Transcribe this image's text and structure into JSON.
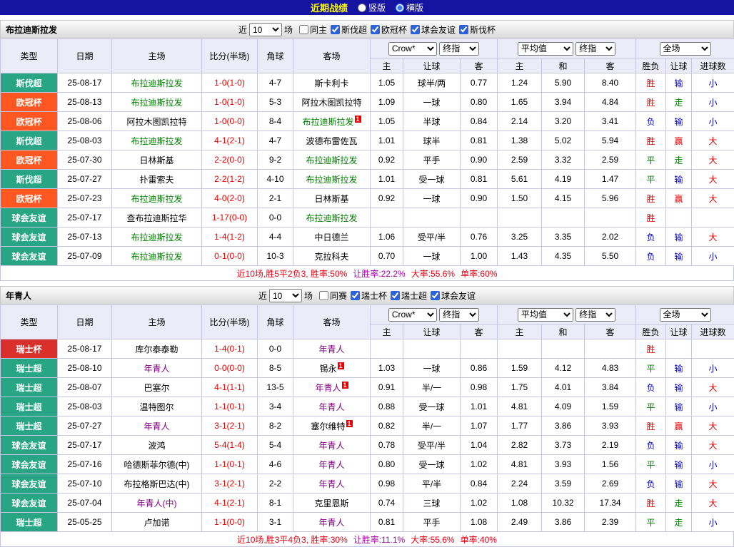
{
  "topbar": {
    "title": "近期战绩",
    "radios": [
      {
        "label": "竖版",
        "selected": false
      },
      {
        "label": "横版",
        "selected": true
      }
    ]
  },
  "table_header": {
    "type": "类型",
    "date": "日期",
    "home": "主场",
    "score": "比分(半场)",
    "corner": "角球",
    "away": "客场",
    "asia_selects": [
      "Crow*",
      "终指"
    ],
    "asia_cols": [
      "主",
      "让球",
      "客"
    ],
    "europe_selects": [
      "平均值",
      "终指"
    ],
    "europe_cols": [
      "主",
      "和",
      "客"
    ],
    "result_select": "全场",
    "result_cols": [
      "胜负",
      "让球",
      "进球数"
    ]
  },
  "league_colors": {
    "斯伐超": "#27a584",
    "欧冠杯": "#ff5722",
    "球会友谊": "#27a584",
    "瑞士杯": "#d9302c",
    "瑞士超": "#27a584"
  },
  "result_colors": {
    "胜": "#e60000",
    "平": "#008000",
    "负": "#0000cc",
    "赢": "#e60000",
    "走": "#008000",
    "输": "#0000cc",
    "大": "#e60000",
    "小": "#0000cc"
  },
  "sections": [
    {
      "team": "布拉迪斯拉发",
      "team_color": "#008000",
      "filters": {
        "near": "近",
        "count": "10",
        "games": "场",
        "checkboxes": [
          {
            "label": "同主",
            "checked": false
          },
          {
            "label": "斯伐超",
            "checked": true
          },
          {
            "label": "欧冠杯",
            "checked": true
          },
          {
            "label": "球会友谊",
            "checked": true
          },
          {
            "label": "斯伐杯",
            "checked": true
          }
        ]
      },
      "rows": [
        {
          "league": "斯伐超",
          "date": "25-08-17",
          "home": "布拉迪斯拉发",
          "home_focus": true,
          "home_red": "",
          "score": "1-0(1-0)",
          "corner": "4-7",
          "away": "斯卡利卡",
          "away_focus": false,
          "away_red": "",
          "asia": [
            "1.05",
            "球半/两",
            "0.77"
          ],
          "europe": [
            "1.24",
            "5.90",
            "8.40"
          ],
          "results": [
            "胜",
            "输",
            "小"
          ]
        },
        {
          "league": "欧冠杯",
          "date": "25-08-13",
          "home": "布拉迪斯拉发",
          "home_focus": true,
          "home_red": "",
          "score": "1-0(1-0)",
          "corner": "5-3",
          "away": "阿拉木图凯拉特",
          "away_focus": false,
          "away_red": "",
          "asia": [
            "1.09",
            "一球",
            "0.80"
          ],
          "europe": [
            "1.65",
            "3.94",
            "4.84"
          ],
          "results": [
            "胜",
            "走",
            "小"
          ]
        },
        {
          "league": "欧冠杯",
          "date": "25-08-06",
          "home": "阿拉木图凯拉特",
          "home_focus": false,
          "home_red": "",
          "score": "1-0(0-0)",
          "corner": "8-4",
          "away": "布拉迪斯拉发",
          "away_focus": true,
          "away_red": "1",
          "asia": [
            "1.05",
            "半球",
            "0.84"
          ],
          "europe": [
            "2.14",
            "3.20",
            "3.41"
          ],
          "results": [
            "负",
            "输",
            "小"
          ]
        },
        {
          "league": "斯伐超",
          "date": "25-08-03",
          "home": "布拉迪斯拉发",
          "home_focus": true,
          "home_red": "",
          "score": "4-1(2-1)",
          "corner": "4-7",
          "away": "波德布雷佐瓦",
          "away_focus": false,
          "away_red": "",
          "asia": [
            "1.01",
            "球半",
            "0.81"
          ],
          "europe": [
            "1.38",
            "5.02",
            "5.94"
          ],
          "results": [
            "胜",
            "赢",
            "大"
          ]
        },
        {
          "league": "欧冠杯",
          "date": "25-07-30",
          "home": "日林斯基",
          "home_focus": false,
          "home_red": "",
          "score": "2-2(0-0)",
          "corner": "9-2",
          "away": "布拉迪斯拉发",
          "away_focus": true,
          "away_red": "",
          "asia": [
            "0.92",
            "平手",
            "0.90"
          ],
          "europe": [
            "2.59",
            "3.32",
            "2.59"
          ],
          "results": [
            "平",
            "走",
            "大"
          ]
        },
        {
          "league": "斯伐超",
          "date": "25-07-27",
          "home": "扑雷索夫",
          "home_focus": false,
          "home_red": "",
          "score": "2-2(1-2)",
          "corner": "4-10",
          "away": "布拉迪斯拉发",
          "away_focus": true,
          "away_red": "",
          "asia": [
            "1.01",
            "受一球",
            "0.81"
          ],
          "europe": [
            "5.61",
            "4.19",
            "1.47"
          ],
          "results": [
            "平",
            "输",
            "大"
          ]
        },
        {
          "league": "欧冠杯",
          "date": "25-07-23",
          "home": "布拉迪斯拉发",
          "home_focus": true,
          "home_red": "",
          "score": "4-0(2-0)",
          "corner": "2-1",
          "away": "日林斯基",
          "away_focus": false,
          "away_red": "",
          "asia": [
            "0.92",
            "一球",
            "0.90"
          ],
          "europe": [
            "1.50",
            "4.15",
            "5.96"
          ],
          "results": [
            "胜",
            "赢",
            "大"
          ]
        },
        {
          "league": "球会友谊",
          "date": "25-07-17",
          "home": "查布拉迪斯拉华",
          "home_focus": false,
          "home_red": "",
          "score": "1-17(0-0)",
          "corner": "0-0",
          "away": "布拉迪斯拉发",
          "away_focus": true,
          "away_red": "",
          "asia": [
            "",
            "",
            ""
          ],
          "europe": [
            "",
            "",
            ""
          ],
          "results": [
            "胜",
            "",
            ""
          ]
        },
        {
          "league": "球会友谊",
          "date": "25-07-13",
          "home": "布拉迪斯拉发",
          "home_focus": true,
          "home_red": "",
          "score": "1-4(1-2)",
          "corner": "4-4",
          "away": "中日德兰",
          "away_focus": false,
          "away_red": "",
          "asia": [
            "1.06",
            "受平/半",
            "0.76"
          ],
          "europe": [
            "3.25",
            "3.35",
            "2.02"
          ],
          "results": [
            "负",
            "输",
            "大"
          ]
        },
        {
          "league": "球会友谊",
          "date": "25-07-09",
          "home": "布拉迪斯拉发",
          "home_focus": true,
          "home_red": "",
          "score": "0-1(0-0)",
          "corner": "10-3",
          "away": "克拉科夫",
          "away_focus": false,
          "away_red": "",
          "asia": [
            "0.70",
            "一球",
            "1.00"
          ],
          "europe": [
            "1.43",
            "4.35",
            "5.50"
          ],
          "results": [
            "负",
            "输",
            "小"
          ]
        }
      ],
      "summary": [
        {
          "text": "近10场,胜5平2负3, 胜率:50%",
          "color": "#e60012"
        },
        {
          "text": "让胜率:22.2%",
          "color": "#aa00aa"
        },
        {
          "text": "大率:55.6%",
          "color": "#e60012"
        },
        {
          "text": "单率:60%",
          "color": "#e60012"
        }
      ]
    },
    {
      "team": "年青人",
      "team_color": "#800080",
      "filters": {
        "near": "近",
        "count": "10",
        "games": "场",
        "checkboxes": [
          {
            "label": "同赛",
            "checked": false
          },
          {
            "label": "瑞士杯",
            "checked": true
          },
          {
            "label": "瑞士超",
            "checked": true
          },
          {
            "label": "球会友谊",
            "checked": true
          }
        ]
      },
      "rows": [
        {
          "league": "瑞士杯",
          "date": "25-08-17",
          "home": "库尔泰泰勒",
          "home_focus": false,
          "home_red": "",
          "score": "1-4(0-1)",
          "corner": "0-0",
          "away": "年青人",
          "away_focus": true,
          "away_red": "",
          "asia": [
            "",
            "",
            ""
          ],
          "europe": [
            "",
            "",
            ""
          ],
          "results": [
            "胜",
            "",
            ""
          ]
        },
        {
          "league": "瑞士超",
          "date": "25-08-10",
          "home": "年青人",
          "home_focus": true,
          "home_red": "",
          "score": "0-0(0-0)",
          "corner": "8-5",
          "away": "锡永",
          "away_focus": false,
          "away_red": "1",
          "asia": [
            "1.03",
            "一球",
            "0.86"
          ],
          "europe": [
            "1.59",
            "4.12",
            "4.83"
          ],
          "results": [
            "平",
            "输",
            "小"
          ]
        },
        {
          "league": "瑞士超",
          "date": "25-08-07",
          "home": "巴塞尔",
          "home_focus": false,
          "home_red": "",
          "score": "4-1(1-1)",
          "corner": "13-5",
          "away": "年青人",
          "away_focus": true,
          "away_red": "1",
          "asia": [
            "0.91",
            "半/一",
            "0.98"
          ],
          "europe": [
            "1.75",
            "4.01",
            "3.84"
          ],
          "results": [
            "负",
            "输",
            "大"
          ]
        },
        {
          "league": "瑞士超",
          "date": "25-08-03",
          "home": "温特图尔",
          "home_focus": false,
          "home_red": "",
          "score": "1-1(0-1)",
          "corner": "3-4",
          "away": "年青人",
          "away_focus": true,
          "away_red": "",
          "asia": [
            "0.88",
            "受一球",
            "1.01"
          ],
          "europe": [
            "4.81",
            "4.09",
            "1.59"
          ],
          "results": [
            "平",
            "输",
            "小"
          ]
        },
        {
          "league": "瑞士超",
          "date": "25-07-27",
          "home": "年青人",
          "home_focus": true,
          "home_red": "",
          "score": "3-1(2-1)",
          "corner": "8-2",
          "away": "塞尔维特",
          "away_focus": false,
          "away_red": "1",
          "asia": [
            "0.82",
            "半/一",
            "1.07"
          ],
          "europe": [
            "1.77",
            "3.86",
            "3.93"
          ],
          "results": [
            "胜",
            "赢",
            "大"
          ]
        },
        {
          "league": "球会友谊",
          "date": "25-07-17",
          "home": "波鸿",
          "home_focus": false,
          "home_red": "",
          "score": "5-4(1-4)",
          "corner": "5-4",
          "away": "年青人",
          "away_focus": true,
          "away_red": "",
          "asia": [
            "0.78",
            "受平/半",
            "1.04"
          ],
          "europe": [
            "2.82",
            "3.73",
            "2.19"
          ],
          "results": [
            "负",
            "输",
            "大"
          ]
        },
        {
          "league": "球会友谊",
          "date": "25-07-16",
          "home": "哈德斯菲尔德(中)",
          "home_focus": false,
          "home_red": "",
          "score": "1-1(0-1)",
          "corner": "4-6",
          "away": "年青人",
          "away_focus": true,
          "away_red": "",
          "asia": [
            "0.80",
            "受一球",
            "1.02"
          ],
          "europe": [
            "4.81",
            "3.93",
            "1.56"
          ],
          "results": [
            "平",
            "输",
            "小"
          ]
        },
        {
          "league": "球会友谊",
          "date": "25-07-10",
          "home": "布拉格斯巴达(中)",
          "home_focus": false,
          "home_red": "",
          "score": "3-1(2-1)",
          "corner": "2-2",
          "away": "年青人",
          "away_focus": true,
          "away_red": "",
          "asia": [
            "0.98",
            "平/半",
            "0.84"
          ],
          "europe": [
            "2.24",
            "3.59",
            "2.69"
          ],
          "results": [
            "负",
            "输",
            "大"
          ]
        },
        {
          "league": "球会友谊",
          "date": "25-07-04",
          "home": "年青人(中)",
          "home_focus": true,
          "home_red": "",
          "score": "4-1(2-1)",
          "corner": "8-1",
          "away": "克里恩斯",
          "away_focus": false,
          "away_red": "",
          "asia": [
            "0.74",
            "三球",
            "1.02"
          ],
          "europe": [
            "1.08",
            "10.32",
            "17.34"
          ],
          "results": [
            "胜",
            "走",
            "大"
          ]
        },
        {
          "league": "瑞士超",
          "date": "25-05-25",
          "home": "卢加诺",
          "home_focus": false,
          "home_red": "",
          "score": "1-1(0-0)",
          "corner": "3-1",
          "away": "年青人",
          "away_focus": true,
          "away_red": "",
          "asia": [
            "0.81",
            "平手",
            "1.08"
          ],
          "europe": [
            "2.49",
            "3.86",
            "2.39"
          ],
          "results": [
            "平",
            "走",
            "小"
          ]
        }
      ],
      "summary": [
        {
          "text": "近10场,胜3平4负3, 胜率:30%",
          "color": "#e60012"
        },
        {
          "text": "让胜率:11.1%",
          "color": "#aa00aa"
        },
        {
          "text": "大率:55.6%",
          "color": "#e60012"
        },
        {
          "text": "单率:40%",
          "color": "#e60012"
        }
      ]
    }
  ]
}
